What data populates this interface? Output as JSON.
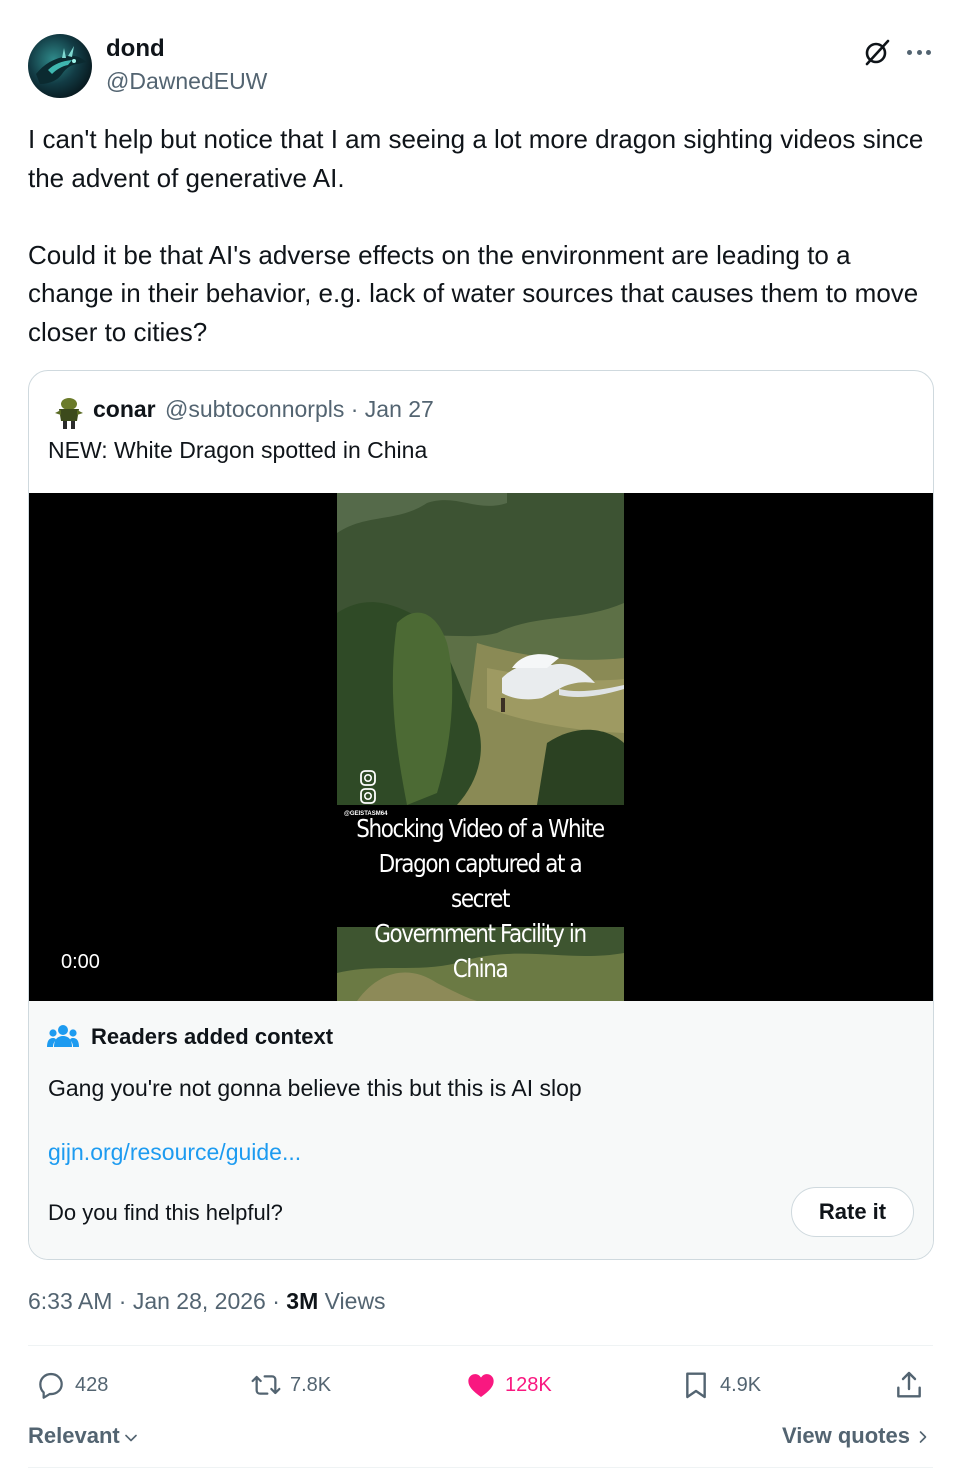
{
  "author": {
    "display_name": "dond",
    "handle": "@DawnedEUW"
  },
  "tweet": {
    "paragraphs": [
      "I can't help but notice that I am seeing a lot more dragon sighting videos since the advent of generative AI.",
      "Could it be that AI's adverse effects on the environment are leading to a change in their behavior, e.g. lack of water sources that causes them to move closer to cities?"
    ]
  },
  "quote": {
    "display_name": "conar",
    "handle_date": "@subtoconnorpls · Jan 27",
    "text": "NEW: White Dragon spotted in China",
    "video": {
      "caption_lines": [
        "Shocking Video of a White",
        "Dragon captured at a secret",
        "Government Facility in China"
      ],
      "watermark_handle": "@GEISTASM64",
      "timestamp": "0:00"
    },
    "context": {
      "title": "Readers added context",
      "body": "Gang you're not gonna believe this but this is AI slop",
      "link": "gijn.org/resource/guide...",
      "question": "Do you find this helpful?",
      "rate_label": "Rate it"
    }
  },
  "meta": {
    "time_date": "6:33 AM · Jan 28, 2026 · ",
    "views_count": "3M",
    "views_label": " Views"
  },
  "actions": {
    "replies": "428",
    "reposts": "7.8K",
    "likes": "128K",
    "bookmarks": "4.9K"
  },
  "footer": {
    "sort_label": "Relevant",
    "view_quotes_label": "View quotes"
  },
  "colors": {
    "text": "#0f1419",
    "secondary": "#536471",
    "link": "#1d9bf0",
    "like": "#f91880",
    "border": "#cfd9de"
  }
}
